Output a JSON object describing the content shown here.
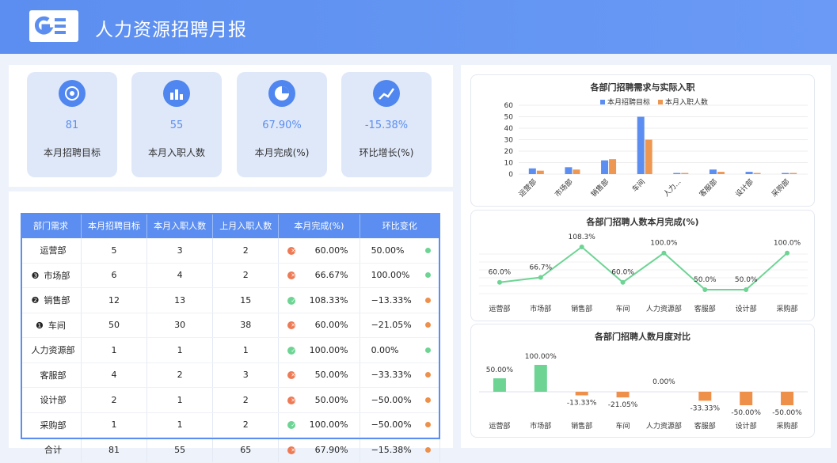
{
  "header": {
    "title": "人力资源招聘月报"
  },
  "colors": {
    "header": "#5b8ef0",
    "target": "#5b8ef0",
    "actual": "#ee9752",
    "line": "#6dd494",
    "positive": "#6dd494",
    "negative": "#ee8f4a"
  },
  "kpis": [
    {
      "value": "81",
      "label": "本月招聘目标",
      "icon": "target-icon"
    },
    {
      "value": "55",
      "label": "本月入职人数",
      "icon": "people-icon"
    },
    {
      "value": "67.90%",
      "label": "本月完成(%)",
      "icon": "pie-icon"
    },
    {
      "value": "-15.38%",
      "label": "环比增长(%)",
      "icon": "trend-icon"
    }
  ],
  "table": {
    "headers": [
      "部门需求",
      "本月招聘目标",
      "本月入职人数",
      "上月入职人数",
      "本月完成(%)",
      "环比变化"
    ],
    "rows": [
      {
        "rank": "",
        "dept": "运营部",
        "target": "5",
        "actual": "3",
        "last": "2",
        "status": "x",
        "done": "60.00%",
        "change": "50.00%",
        "trend": "up"
      },
      {
        "rank": "❸",
        "dept": "市场部",
        "target": "6",
        "actual": "4",
        "last": "2",
        "status": "x",
        "done": "66.67%",
        "change": "100.00%",
        "trend": "up"
      },
      {
        "rank": "❷",
        "dept": "销售部",
        "target": "12",
        "actual": "13",
        "last": "15",
        "status": "ok",
        "done": "108.33%",
        "change": "−13.33%",
        "trend": "down"
      },
      {
        "rank": "❶",
        "dept": "车间",
        "target": "50",
        "actual": "30",
        "last": "38",
        "status": "x",
        "done": "60.00%",
        "change": "−21.05%",
        "trend": "down"
      },
      {
        "rank": "",
        "dept": "人力资源部",
        "target": "1",
        "actual": "1",
        "last": "1",
        "status": "ok",
        "done": "100.00%",
        "change": "0.00%",
        "trend": "up"
      },
      {
        "rank": "",
        "dept": "客服部",
        "target": "4",
        "actual": "2",
        "last": "3",
        "status": "x",
        "done": "50.00%",
        "change": "−33.33%",
        "trend": "down"
      },
      {
        "rank": "",
        "dept": "设计部",
        "target": "2",
        "actual": "1",
        "last": "2",
        "status": "x",
        "done": "50.00%",
        "change": "−50.00%",
        "trend": "down"
      },
      {
        "rank": "",
        "dept": "采购部",
        "target": "1",
        "actual": "1",
        "last": "2",
        "status": "ok",
        "done": "100.00%",
        "change": "−50.00%",
        "trend": "down"
      },
      {
        "rank": "",
        "dept": "合计",
        "target": "81",
        "actual": "55",
        "last": "65",
        "status": "x",
        "done": "67.90%",
        "change": "−15.38%",
        "trend": "down"
      }
    ]
  },
  "chart_data": [
    {
      "type": "bar",
      "title": "各部门招聘需求与实际入职",
      "categories": [
        "运营部",
        "市场部",
        "销售部",
        "车间",
        "人力...",
        "客服部",
        "设计部",
        "采购部"
      ],
      "series": [
        {
          "name": "本月招聘目标",
          "values": [
            5,
            6,
            12,
            50,
            1,
            4,
            2,
            1
          ]
        },
        {
          "name": "本月入职人数",
          "values": [
            3,
            4,
            13,
            30,
            1,
            2,
            1,
            1
          ]
        }
      ],
      "ylim": [
        0,
        60
      ],
      "yticks": [
        "0",
        "10",
        "20",
        "30",
        "40",
        "50",
        "60"
      ],
      "legend": "top-right"
    },
    {
      "type": "line",
      "title": "各部门招聘人数本月完成(%)",
      "categories": [
        "运营部",
        "市场部",
        "销售部",
        "车间",
        "人力资源部",
        "客服部",
        "设计部",
        "采购部"
      ],
      "values": [
        60.0,
        66.7,
        108.3,
        60.0,
        100.0,
        50.0,
        50.0,
        100.0
      ],
      "labels": [
        "60.0%",
        "66.7%",
        "108.3%",
        "60.0%",
        "100.0%",
        "50.0%",
        "50.0%",
        "100.0%"
      ]
    },
    {
      "type": "bar",
      "title": "各部门招聘人数月度对比",
      "categories": [
        "运营部",
        "市场部",
        "销售部",
        "车间",
        "人力资源部",
        "客服部",
        "设计部",
        "采购部"
      ],
      "values": [
        50.0,
        100.0,
        -13.33,
        -21.05,
        0.0,
        -33.33,
        -50.0,
        -50.0
      ],
      "labels": [
        "50.00%",
        "100.00%",
        "-13.33%",
        "-21.05%",
        "0.00%",
        "-33.33%",
        "-50.00%",
        "-50.00%"
      ]
    }
  ]
}
